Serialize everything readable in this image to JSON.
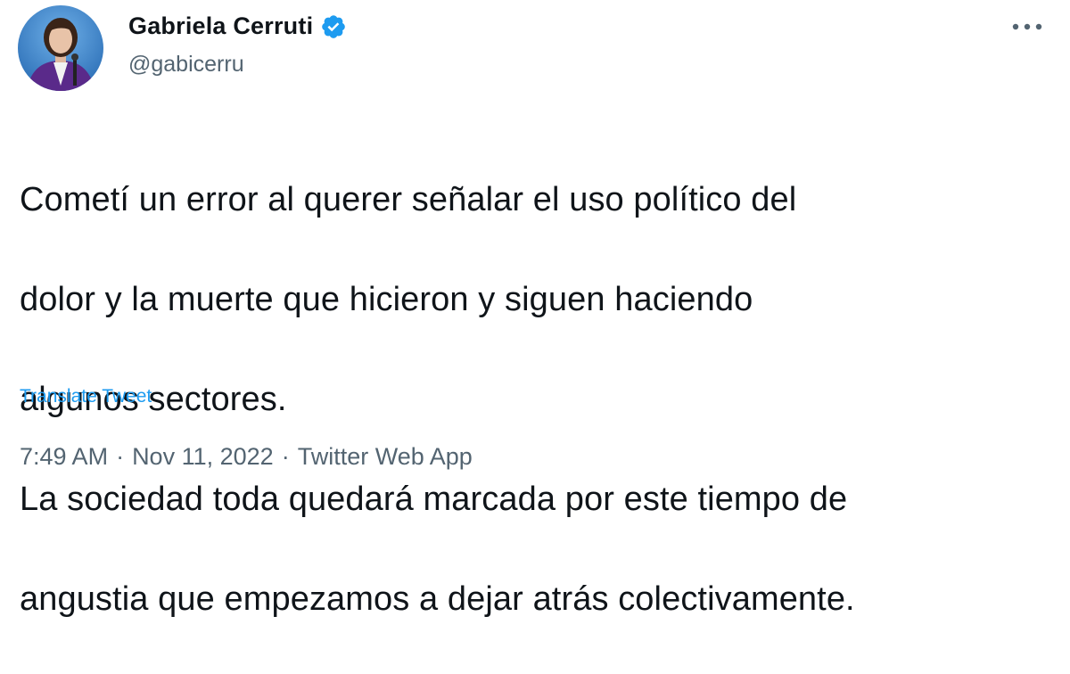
{
  "user": {
    "display_name": "Gabriela Cerruti",
    "handle": "@gabicerru",
    "verified_icon": "verified-badge-icon",
    "avatar_icon": "avatar"
  },
  "tweet": {
    "text_lines": [
      "Cometí un error al querer señalar el uso político del",
      "dolor y la muerte que hicieron y siguen haciendo",
      "algunos sectores.",
      "La sociedad toda quedará marcada por este tiempo de",
      "angustia que empezamos a dejar atrás colectivamente."
    ],
    "translate_label": "Translate Tweet"
  },
  "meta": {
    "time": "7:49 AM",
    "separator": "·",
    "date": "Nov 11, 2022",
    "source": "Twitter Web App"
  },
  "menu": {
    "more_icon": "more-options-icon"
  },
  "colors": {
    "text": "#0f1419",
    "secondary": "#536471",
    "link": "#1d9bf0",
    "verified": "#1d9bf0"
  }
}
